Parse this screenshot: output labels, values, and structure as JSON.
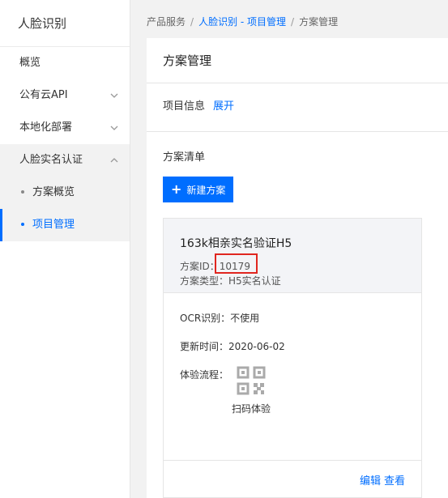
{
  "sidebar": {
    "title": "人脸识别",
    "items": [
      {
        "label": "概览"
      },
      {
        "label": "公有云API"
      },
      {
        "label": "本地化部署"
      },
      {
        "label": "人脸实名认证"
      }
    ],
    "sub_items": [
      {
        "label": "方案概览"
      },
      {
        "label": "项目管理"
      }
    ]
  },
  "breadcrumb": {
    "root": "产品服务",
    "sep": "/",
    "link": "人脸识别 - 项目管理",
    "current": "方案管理"
  },
  "panel": {
    "title": "方案管理",
    "info_label": "项目信息",
    "info_expand": "展开",
    "list_title": "方案清单",
    "new_button": "新建方案"
  },
  "card": {
    "name": "163k相亲实名验证H5",
    "id_label": "方案ID：",
    "id_value": "10179",
    "type_label": "方案类型：",
    "type_value": "H5实名认证",
    "ocr_label": "OCR识别：",
    "ocr_value": "不使用",
    "updated_label": "更新时间：",
    "updated_value": "2020-06-02",
    "flow_label": "体验流程：",
    "qr_label": "扫码体验",
    "edit": "编辑",
    "view": "查看"
  },
  "colors": {
    "accent": "#006eff",
    "highlight": "#e0261f"
  }
}
